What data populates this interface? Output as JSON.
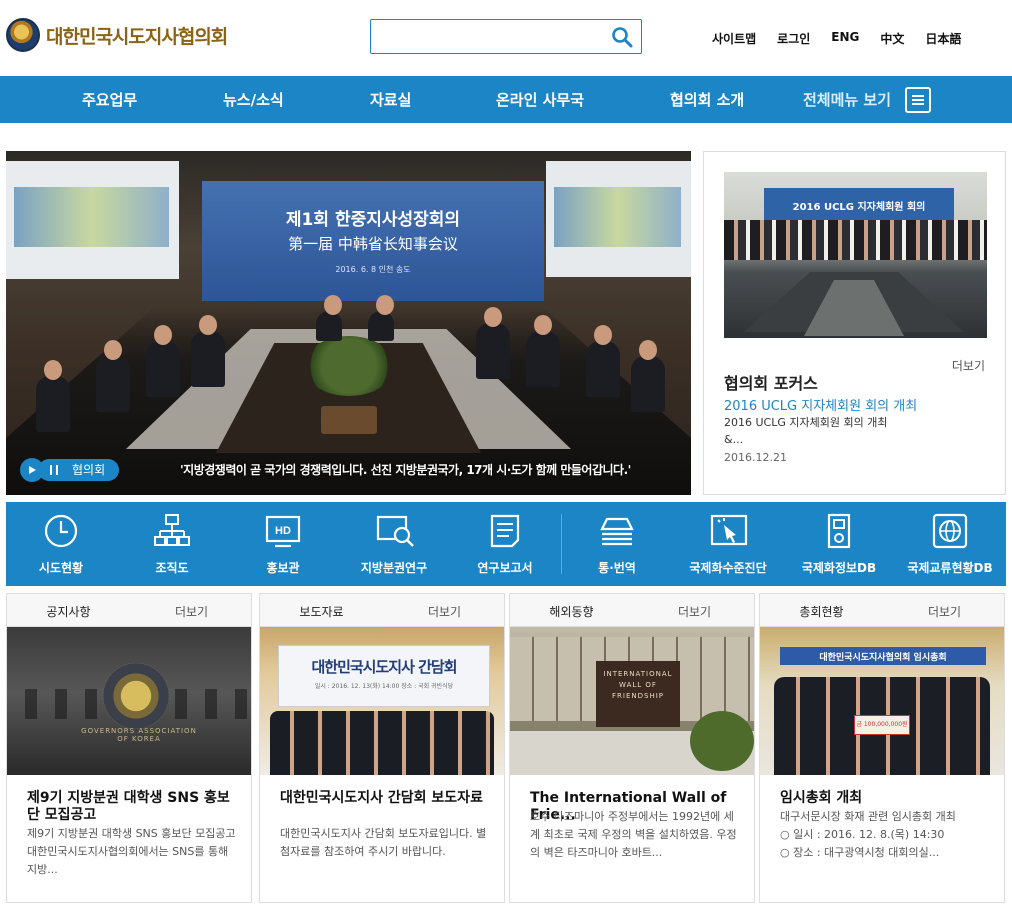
{
  "header": {
    "logo_text": "대한민국시도지사협의회",
    "search_placeholder": "",
    "util_links": [
      "사이트맵",
      "로그인",
      "ENG",
      "中文",
      "日本語"
    ]
  },
  "nav": {
    "items": [
      "주요업무",
      "뉴스/소식",
      "자료실",
      "온라인 사무국",
      "협의회 소개"
    ],
    "all_menu": "전체메뉴 보기"
  },
  "hero": {
    "banner_line1": "제1회 한중지사성장회의",
    "banner_line2": "第一届 中韩省长知事会议",
    "banner_line3": "2016. 6. 8 인천 송도",
    "tag": "협의회",
    "caption": "'지방경쟁력이 곧 국가의 경쟁력입니다. 선진 지방분권국가, 17개 시·도가 함께 만들어갑니다.'"
  },
  "focus": {
    "photo_banner": "2016 UCLG 지자체회원 회의",
    "more": "더보기",
    "title": "협의회 포커스",
    "subtitle": "2016 UCLG 지자체회원 회의 개최",
    "desc_line1": "2016 UCLG 지자체회원 회의 개최",
    "desc_line2": "&...",
    "date": "2016.12.21"
  },
  "quick": {
    "items": [
      {
        "label": "시도현황",
        "icon": "clock-icon"
      },
      {
        "label": "조직도",
        "icon": "org-chart-icon"
      },
      {
        "label": "홍보관",
        "icon": "hd-monitor-icon"
      },
      {
        "label": "지방분권연구",
        "icon": "search-document-icon"
      },
      {
        "label": "연구보고서",
        "icon": "report-icon"
      },
      {
        "label": "통·번역",
        "icon": "layers-icon"
      },
      {
        "label": "국제화수준진단",
        "icon": "diagnosis-icon"
      },
      {
        "label": "국제화정보DB",
        "icon": "database-icon"
      },
      {
        "label": "국제교류현황DB",
        "icon": "globe-icon"
      }
    ]
  },
  "cards": [
    {
      "category": "공지사항",
      "more": "더보기",
      "image_caption": "GOVERNORS ASSOCIATION OF KOREA",
      "title": "제9기 지방분권 대학생 SNS 홍보단 모집공고",
      "text": "제9기 지방분권 대학생 SNS 홍보단 모집공고 대한민국시도지사협의회에서는 SNS를 통해 지방..."
    },
    {
      "category": "보도자료",
      "more": "더보기",
      "image_banner": "대한민국시도지사 간담회",
      "image_sub": "일시 : 2016. 12. 13(화) 14:00  장소 : 국회 귀빈식당",
      "title": "대한민국시도지사 간담회 보도자료",
      "text": "대한민국시도지사 간담회 보도자료입니다. 별첨자료를 참조하여 주시기 바랍니다."
    },
    {
      "category": "해외동향",
      "more": "더보기",
      "image_caption": "INTERNATIONAL WALL OF FRIENDSHIP",
      "title": "The International Wall of Frie...",
      "text": "호주 타즈마니아 주정부에서는 1992년에 세계 최초로 국제 우정의 벽을 설치하였음. 우정의 벽은 타즈마니아 호바트..."
    },
    {
      "category": "총회현황",
      "more": "더보기",
      "image_banner": "대한민국시도지사협의회 임시총회",
      "image_check": "금 100,000,000원",
      "title": "임시총회 개최",
      "text_line1": "대구서문시장 화재 관련 임시총회 개최",
      "text_line2": "○ 일시 : 2016. 12. 8.(목) 14:30",
      "text_line3": "○ 장소 : 대구광역시청 대회의실..."
    }
  ],
  "colors": {
    "brand_blue": "#1c85c5",
    "logo_gold": "#8a6416"
  }
}
